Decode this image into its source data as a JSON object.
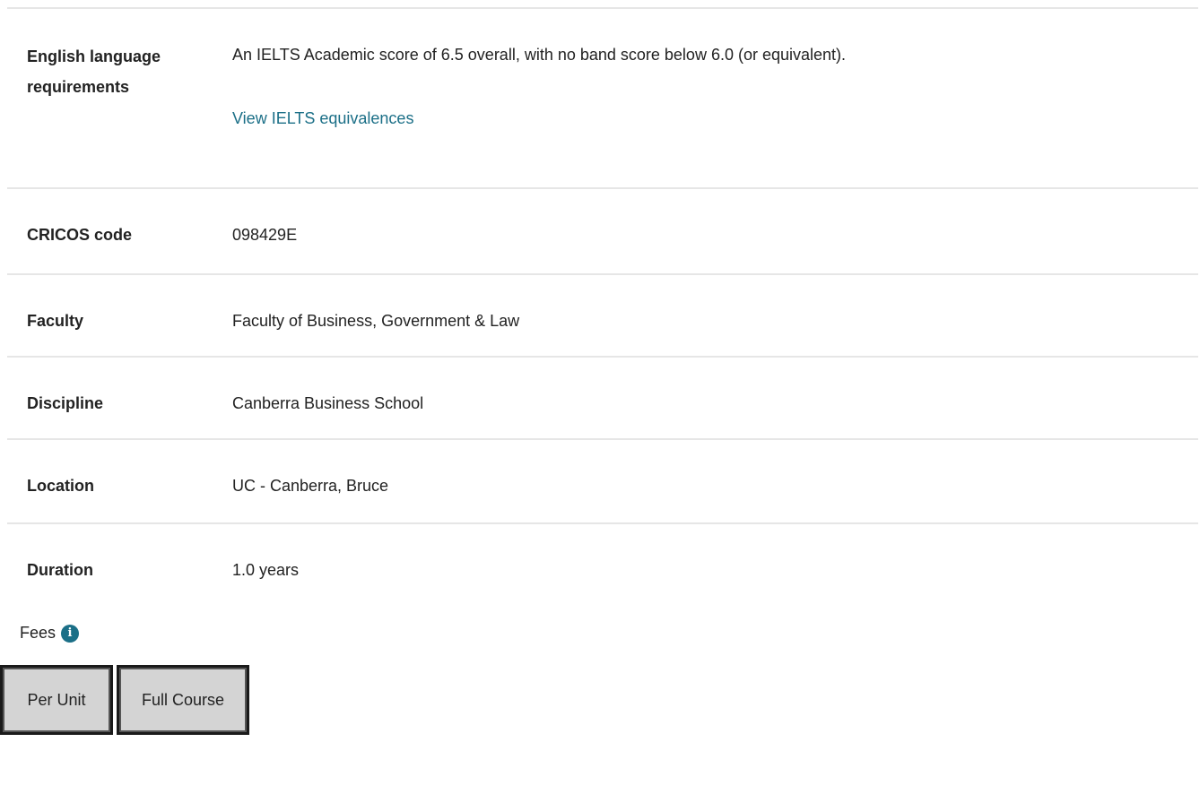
{
  "details": {
    "english": {
      "label_line1": "English language",
      "label_line2": "requirements",
      "value": "An IELTS Academic score of 6.5 overall, with no band score below 6.0 (or equivalent).",
      "link": "View IELTS equivalences"
    },
    "cricos": {
      "label": "CRICOS code",
      "value": "098429E"
    },
    "faculty": {
      "label": "Faculty",
      "value": "Faculty of Business, Government & Law"
    },
    "discipline": {
      "label": "Discipline",
      "value": "Canberra Business School"
    },
    "location": {
      "label": "Location",
      "value": "UC - Canberra, Bruce"
    },
    "duration": {
      "label": "Duration",
      "value": "1.0 years"
    }
  },
  "fees": {
    "title": "Fees",
    "info_icon": "info-icon",
    "tabs": [
      "Per Unit",
      "Full Course"
    ]
  },
  "colors": {
    "link": "#1b6f87",
    "divider": "#e6e6e6",
    "tab_bg": "#d4d4d4"
  }
}
